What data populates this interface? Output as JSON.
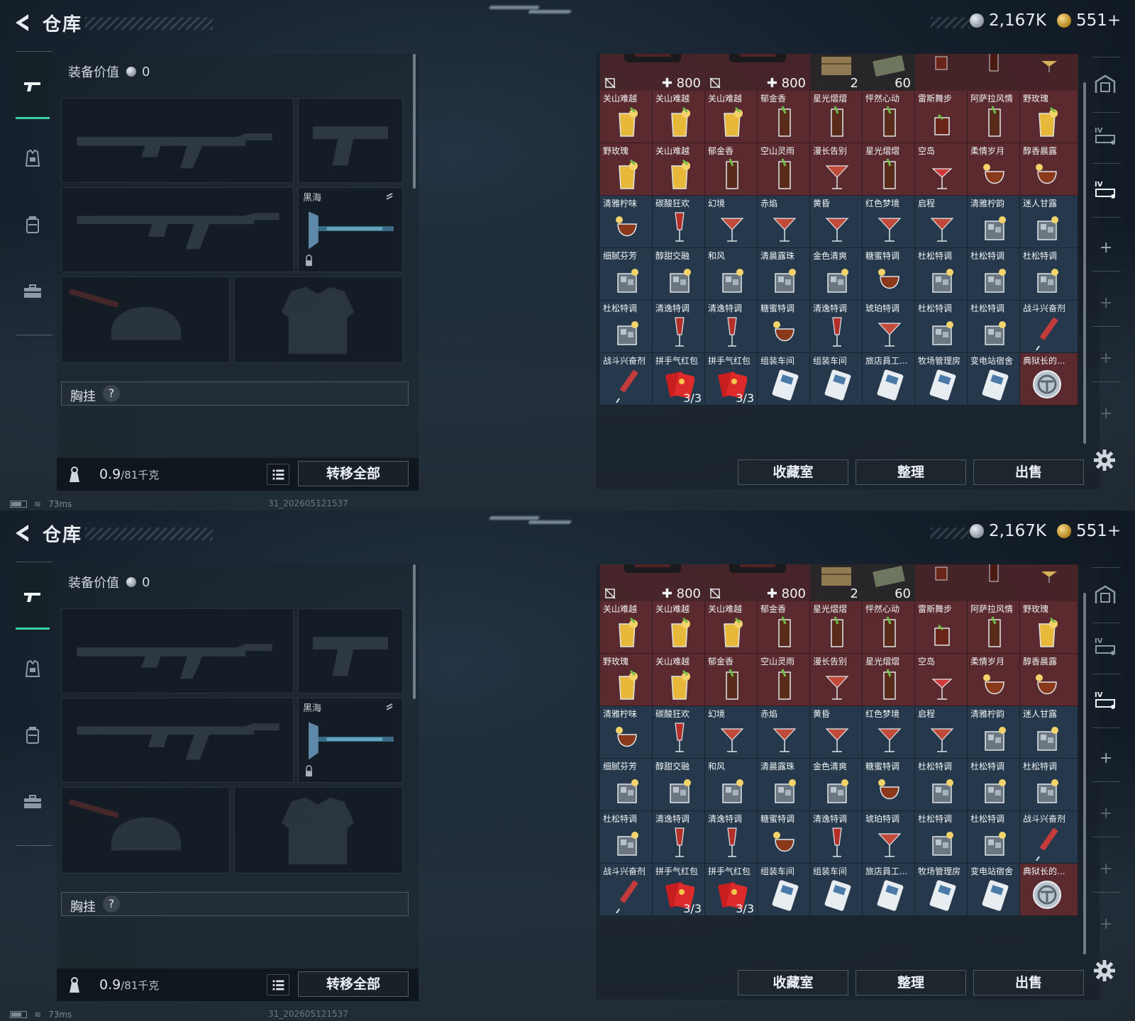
{
  "window": {
    "title": "仓库"
  },
  "currency": {
    "coins": "2,167K",
    "gold": "551+"
  },
  "loadout": {
    "equip_value_label": "装备价值",
    "equip_value": "0",
    "melee_name": "黑海",
    "chest_label": "胸挂",
    "help": "?",
    "weight": "0.9",
    "weight_max": "/81千克",
    "transfer_all": "转移全部"
  },
  "stash": {
    "header_counts": [
      "800",
      "800",
      "2",
      "60"
    ],
    "rows": [
      [
        {
          "name": "关山难越",
          "color": "red",
          "icon": "cocktail-highball-icon"
        },
        {
          "name": "关山难越",
          "color": "red",
          "icon": "cocktail-highball-icon"
        },
        {
          "name": "关山难越",
          "color": "red",
          "icon": "cocktail-highball-icon"
        },
        {
          "name": "郁金香",
          "color": "red",
          "icon": "cocktail-tall-icon"
        },
        {
          "name": "星光熠熠",
          "color": "red",
          "icon": "cocktail-tall-icon"
        },
        {
          "name": "怦然心动",
          "color": "red",
          "icon": "cocktail-tall-icon"
        },
        {
          "name": "雷斯舞步",
          "color": "red",
          "icon": "cocktail-tumbler-icon"
        },
        {
          "name": "阿萨拉风情",
          "color": "red",
          "icon": "cocktail-tall-icon"
        },
        {
          "name": "野玫瑰",
          "color": "red",
          "icon": "cocktail-highball-icon"
        }
      ],
      [
        {
          "name": "野玫瑰",
          "color": "red",
          "icon": "cocktail-highball-icon"
        },
        {
          "name": "关山难越",
          "color": "red",
          "icon": "cocktail-highball-icon"
        },
        {
          "name": "郁金香",
          "color": "red",
          "icon": "cocktail-tall-icon"
        },
        {
          "name": "空山灵雨",
          "color": "red",
          "icon": "cocktail-tall-icon"
        },
        {
          "name": "漫长告别",
          "color": "red",
          "icon": "cocktail-martini-icon"
        },
        {
          "name": "星光熠熠",
          "color": "red",
          "icon": "cocktail-tall-icon"
        },
        {
          "name": "空岛",
          "color": "red",
          "icon": "cocktail-coupe-icon"
        },
        {
          "name": "柔情岁月",
          "color": "red",
          "icon": "cocktail-snifter-icon"
        },
        {
          "name": "醇香晨露",
          "color": "red",
          "icon": "cocktail-snifter-icon"
        }
      ],
      [
        {
          "name": "清雅柠味",
          "color": "blue",
          "icon": "cocktail-snifter-icon"
        },
        {
          "name": "碳酸狂欢",
          "color": "blue",
          "icon": "cocktail-flute-icon"
        },
        {
          "name": "幻境",
          "color": "blue",
          "icon": "cocktail-martini-icon"
        },
        {
          "name": "赤焰",
          "color": "blue",
          "icon": "cocktail-martini-icon"
        },
        {
          "name": "黄昏",
          "color": "blue",
          "icon": "cocktail-martini-icon"
        },
        {
          "name": "红色梦境",
          "color": "blue",
          "icon": "cocktail-martini-icon"
        },
        {
          "name": "启程",
          "color": "blue",
          "icon": "cocktail-martini-icon"
        },
        {
          "name": "清雅柠韵",
          "color": "blue",
          "icon": "cocktail-rocks-icon"
        },
        {
          "name": "迷人甘露",
          "color": "blue",
          "icon": "cocktail-rocks-icon"
        }
      ],
      [
        {
          "name": "细腻芬芳",
          "color": "blue",
          "icon": "cocktail-rocks-icon"
        },
        {
          "name": "醇甜交融",
          "color": "blue",
          "icon": "cocktail-rocks-icon"
        },
        {
          "name": "和风",
          "color": "blue",
          "icon": "cocktail-rocks-icon"
        },
        {
          "name": "清晨露珠",
          "color": "blue",
          "icon": "cocktail-rocks-icon"
        },
        {
          "name": "金色清爽",
          "color": "blue",
          "icon": "cocktail-rocks-icon"
        },
        {
          "name": "糖蜜特调",
          "color": "blue",
          "icon": "cocktail-snifter-icon"
        },
        {
          "name": "杜松特调",
          "color": "blue",
          "icon": "cocktail-rocks-icon"
        },
        {
          "name": "杜松特调",
          "color": "blue",
          "icon": "cocktail-rocks-icon"
        },
        {
          "name": "杜松特调",
          "color": "blue",
          "icon": "cocktail-rocks-icon"
        }
      ],
      [
        {
          "name": "杜松特调",
          "color": "blue",
          "icon": "cocktail-rocks-icon"
        },
        {
          "name": "清逸特调",
          "color": "blue",
          "icon": "cocktail-flute-icon"
        },
        {
          "name": "清逸特调",
          "color": "blue",
          "icon": "cocktail-flute-icon"
        },
        {
          "name": "糖蜜特调",
          "color": "blue",
          "icon": "cocktail-snifter-icon"
        },
        {
          "name": "清逸特调",
          "color": "blue",
          "icon": "cocktail-flute-icon"
        },
        {
          "name": "琥珀特调",
          "color": "blue",
          "icon": "cocktail-martini-icon"
        },
        {
          "name": "杜松特调",
          "color": "blue",
          "icon": "cocktail-rocks-icon"
        },
        {
          "name": "杜松特调",
          "color": "blue",
          "icon": "cocktail-rocks-icon"
        },
        {
          "name": "战斗兴奋剂",
          "color": "blue",
          "icon": "syringe-icon"
        }
      ],
      [
        {
          "name": "战斗兴奋剂",
          "color": "blue",
          "icon": "syringe-icon"
        },
        {
          "name": "拼手气红包",
          "color": "blue",
          "icon": "red-envelope-icon",
          "qty": "3/3"
        },
        {
          "name": "拼手气红包",
          "color": "blue",
          "icon": "red-envelope-icon",
          "qty": "3/3"
        },
        {
          "name": "组装车间",
          "color": "blue",
          "icon": "keycard-icon"
        },
        {
          "name": "组装车间",
          "color": "blue",
          "icon": "keycard-icon"
        },
        {
          "name": "旅店員工...",
          "color": "blue",
          "icon": "keycard-icon"
        },
        {
          "name": "牧场管理房",
          "color": "blue",
          "icon": "keycard-icon"
        },
        {
          "name": "变电站宿舍",
          "color": "blue",
          "icon": "keycard-icon"
        },
        {
          "name": "典狱长的...",
          "color": "red",
          "icon": "medallion-icon"
        }
      ]
    ],
    "buttons": {
      "collection": "收藏室",
      "sort": "整理",
      "sell": "出售"
    }
  },
  "status": {
    "ping": "73ms",
    "build": "31_202605121537"
  },
  "colors": {
    "accent": "#39d2a0",
    "rare_red": "#5a2a2e",
    "rare_blue": "#26394c"
  }
}
